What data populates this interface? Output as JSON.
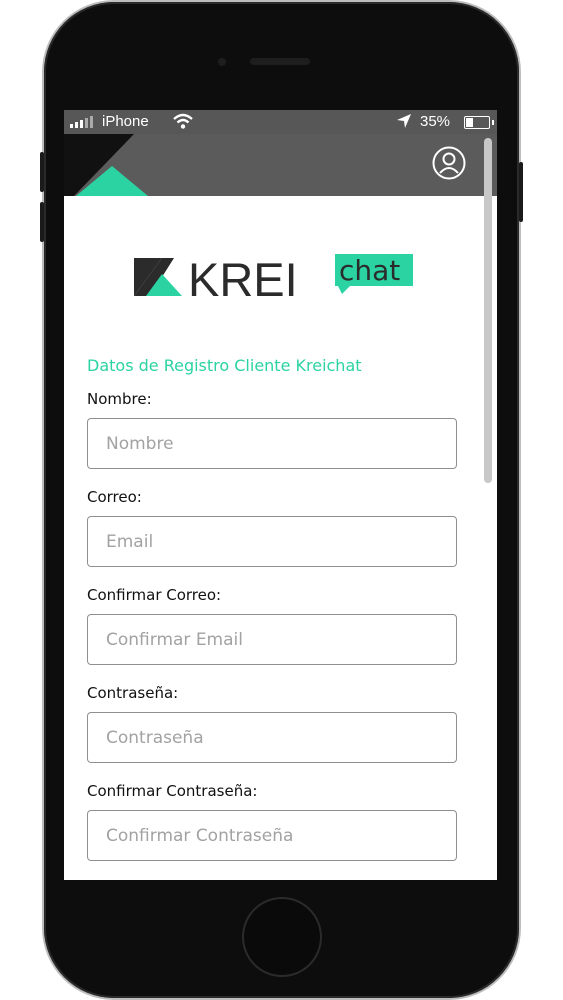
{
  "status_bar": {
    "carrier": "iPhone",
    "battery_percent": "35%",
    "battery_level": 0.35
  },
  "brand": {
    "logo_main": "KREI",
    "logo_bubble": "chat",
    "accent": "#2bd3a3",
    "dark": "#3a3a3a"
  },
  "header": {
    "user_icon": "user-circle-icon"
  },
  "form": {
    "title": "Datos de Registro Cliente Kreichat",
    "fields": [
      {
        "label": "Nombre:",
        "placeholder": "Nombre"
      },
      {
        "label": "Correo:",
        "placeholder": "Email"
      },
      {
        "label": "Confirmar Correo:",
        "placeholder": "Confirmar Email"
      },
      {
        "label": "Contraseña:",
        "placeholder": "Contraseña"
      },
      {
        "label": "Confirmar Contraseña:",
        "placeholder": "Confirmar Contraseña"
      }
    ]
  }
}
